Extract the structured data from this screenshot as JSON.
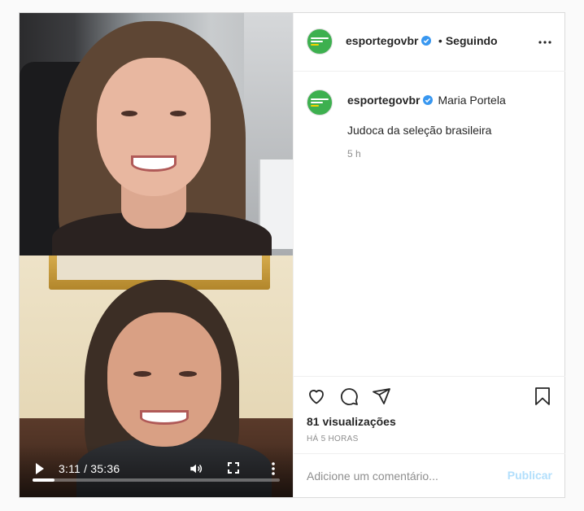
{
  "video": {
    "time_label": "3:11 / 35:36",
    "progress": 0.09
  },
  "header": {
    "username": "esportegovbr",
    "separator": "•",
    "follow_status": "Seguindo"
  },
  "post_comment": {
    "username": "esportegovbr",
    "mention": "Maria Portela",
    "caption": "Judoca da seleção brasileira",
    "age": "5 h"
  },
  "actions": {
    "views": "81 visualizações",
    "timestamp": "HÁ 5 HORAS"
  },
  "add_comment": {
    "placeholder": "Adicione um comentário...",
    "publish_label": "Publicar"
  },
  "colors": {
    "avatar_bg": "#3db04f",
    "verified": "#3897f0",
    "publish_disabled": "#b2dffc"
  },
  "icons": [
    "play-icon",
    "volume-icon",
    "fullscreen-icon",
    "more-vertical-icon",
    "more-horizontal-icon",
    "verified-badge-icon",
    "heart-icon",
    "comment-icon",
    "share-icon",
    "bookmark-icon"
  ]
}
